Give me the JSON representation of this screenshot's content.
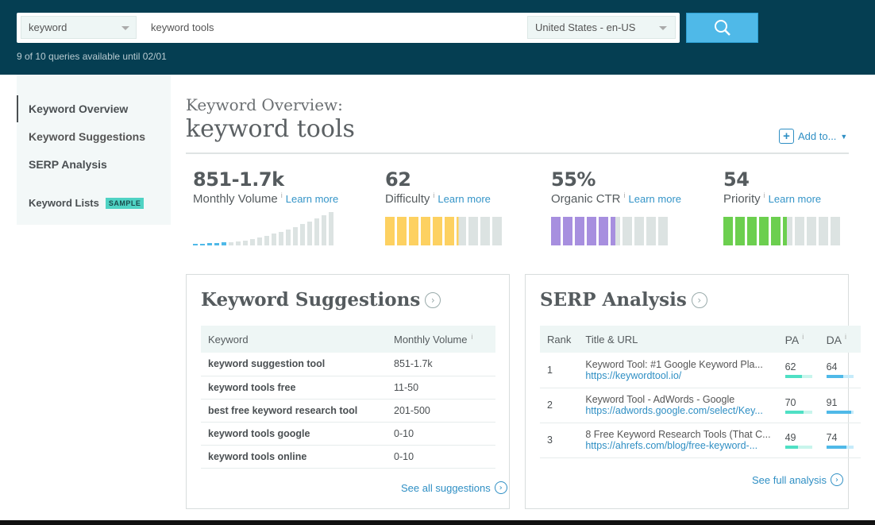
{
  "header": {
    "search_type": "keyword",
    "query": "keyword tools",
    "locale": "United States - en-US",
    "quota": "9 of 10 queries available until 02/01"
  },
  "sidebar": {
    "items": [
      {
        "label": "Keyword Overview",
        "active": true
      },
      {
        "label": "Keyword Suggestions"
      },
      {
        "label": "SERP Analysis"
      },
      {
        "label": "Keyword Lists",
        "badge": "SAMPLE"
      }
    ]
  },
  "overview": {
    "label": "Keyword Overview:",
    "keyword": "keyword tools",
    "add_to": "Add to..."
  },
  "metrics": [
    {
      "value": "851-1.7k",
      "label": "Monthly Volume",
      "learn": "Learn more",
      "volume_bars_highlighted": 5,
      "volume_bars_total": 20
    },
    {
      "value": "62",
      "label": "Difficulty",
      "learn": "Learn more",
      "fill": 62,
      "color": "#fdd161"
    },
    {
      "value": "55%",
      "label": "Organic CTR",
      "learn": "Learn more",
      "fill": 55,
      "color": "#a78fdf"
    },
    {
      "value": "54",
      "label": "Priority",
      "learn": "Learn more",
      "fill": 54,
      "color": "#6ccf4f"
    }
  ],
  "suggestions": {
    "title": "Keyword Suggestions",
    "columns": [
      "Keyword",
      "Monthly Volume"
    ],
    "rows": [
      [
        "keyword suggestion tool",
        "851-1.7k"
      ],
      [
        "keyword tools free",
        "11-50"
      ],
      [
        "best free keyword research tool",
        "201-500"
      ],
      [
        "keyword tools google",
        "0-10"
      ],
      [
        "keyword tools online",
        "0-10"
      ]
    ],
    "link": "See all suggestions"
  },
  "serp": {
    "title": "SERP Analysis",
    "columns": [
      "Rank",
      "Title & URL",
      "PA",
      "DA"
    ],
    "rows": [
      {
        "rank": "1",
        "title": "Keyword Tool: #1 Google Keyword Pla...",
        "url": "https://keywordtool.io/",
        "pa": "62",
        "da": "64"
      },
      {
        "rank": "2",
        "title": "Keyword Tool - AdWords - Google",
        "url": "https://adwords.google.com/select/Key...",
        "pa": "70",
        "da": "91"
      },
      {
        "rank": "3",
        "title": "8 Free Keyword Research Tools (That C...",
        "url": "https://ahrefs.com/blog/free-keyword-...",
        "pa": "49",
        "da": "74"
      }
    ],
    "link": "See full analysis"
  },
  "colors": {
    "header": "#053e52",
    "accent": "#4fb9e8",
    "link": "#2f8fc4",
    "pa": "#4fe0c4",
    "da": "#4fb9e8"
  }
}
